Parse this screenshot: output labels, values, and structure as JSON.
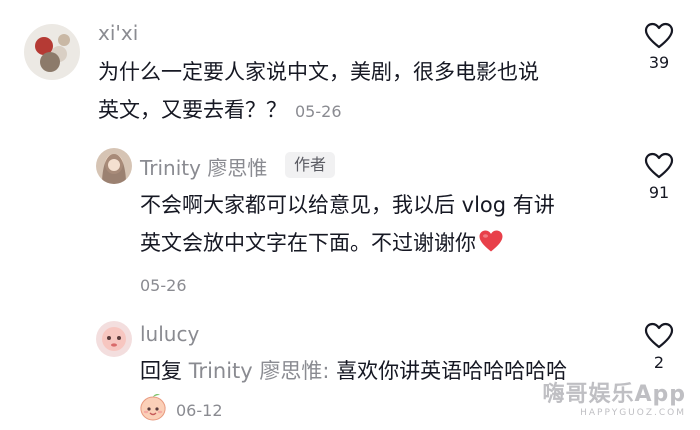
{
  "comments": [
    {
      "username": "xi'xi",
      "text_line1": "为什么一定要人家说中文，美剧，很多电影也说",
      "text_line2": "英文，又要去看？？",
      "date": "05-26",
      "like_count": "39"
    },
    {
      "username": "Trinity 廖思惟",
      "badge": "作者",
      "text_line1": "不会啊大家都可以给意见，我以后 vlog 有讲",
      "text_line2": "英文会放中文字在下面。不过谢谢你",
      "emoji": "red-heart",
      "date": "05-26",
      "like_count": "91"
    },
    {
      "username": "lulucy",
      "reply_prefix": "回复",
      "reply_target": "Trinity 廖思惟:",
      "text": "喜欢你讲英语哈哈哈哈哈",
      "sticker": "peach-face-sticker",
      "date": "06-12",
      "like_count": "2"
    }
  ],
  "watermark": {
    "main": "嗨哥娱乐App",
    "sub": "HAPPYGUOZ.COM"
  },
  "icons": {
    "like": "heart-outline-icon"
  },
  "colors": {
    "text": "#161823",
    "secondary": "#8a8b91",
    "heart_emoji": "#e8404a"
  }
}
